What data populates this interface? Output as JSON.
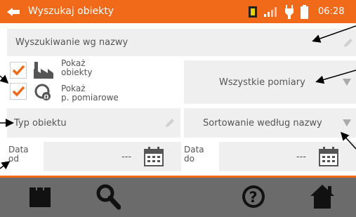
{
  "statusbar": {
    "title": "Wyszukaj obiekty",
    "time": "06:28"
  },
  "search": {
    "placeholder": "Wyszukiwanie wg nazwy"
  },
  "filters": {
    "show_objects_line1": "Pokaż",
    "show_objects_line2": "obiekty",
    "show_points_line1": "Pokaż",
    "show_points_line2": "p. pomiarowe",
    "measurements_select": "Wszystkie pomiary",
    "object_type_placeholder": "Typ obiektu",
    "sort_select": "Sortowanie według nazwy"
  },
  "dates": {
    "from_label_line1": "Data",
    "from_label_line2": "od",
    "from_value": "---",
    "to_label_line1": "Data",
    "to_label_line2": "do",
    "to_value": "---"
  },
  "colors": {
    "accent": "#f16a1a",
    "toolbar": "#6b6b6b",
    "field_bg": "#efefef"
  },
  "icons": [
    "back-arrow-icon",
    "sim-card-icon",
    "signal-icon",
    "charger-icon",
    "battery-icon",
    "pencil-icon",
    "factory-icon",
    "measurement-point-icon",
    "chevron-down-icon",
    "calendar-icon",
    "meter-icon",
    "search-icon",
    "help-icon",
    "home-icon"
  ]
}
